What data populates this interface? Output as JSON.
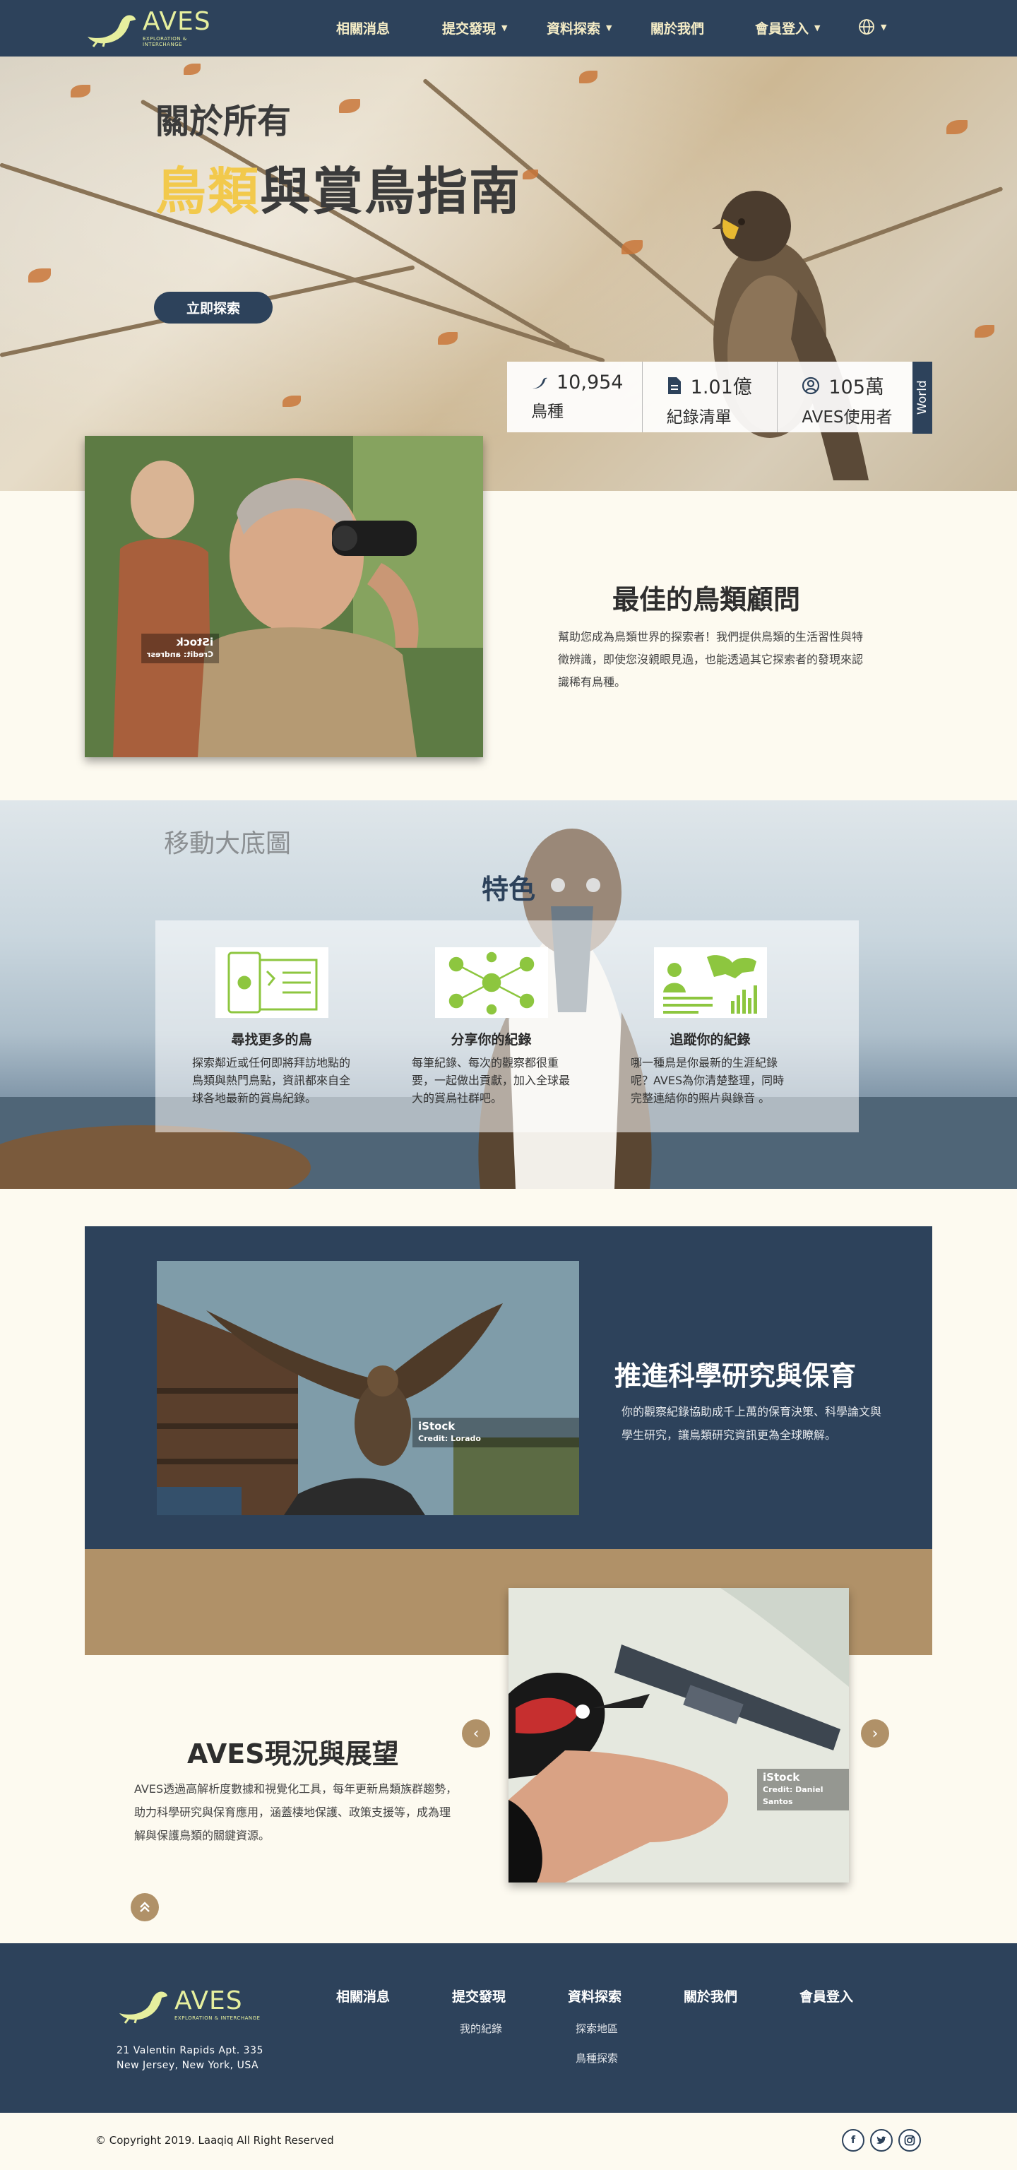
{
  "nav": {
    "brand": "AVES",
    "tagline": "EXPLORATION & INTERCHANGE",
    "items": [
      {
        "label": "相關消息",
        "has_dropdown": false
      },
      {
        "label": "提交發現",
        "has_dropdown": true
      },
      {
        "label": "資料探索",
        "has_dropdown": true
      },
      {
        "label": "關於我們",
        "has_dropdown": false
      },
      {
        "label": "會員登入",
        "has_dropdown": true
      }
    ],
    "language_icon": "globe-icon"
  },
  "hero": {
    "line1": "關於所有",
    "line2_highlight": "鳥類",
    "line2_rest": "與賞鳥指南",
    "explore_button": "立即探索",
    "stats": [
      {
        "icon": "bird-icon",
        "value": "10,954",
        "label": "鳥種"
      },
      {
        "icon": "document-icon",
        "value": "1.01億",
        "label": "紀錄清單"
      },
      {
        "icon": "user-icon",
        "value": "105萬",
        "label": "AVES使用者"
      }
    ],
    "world_tab": "World"
  },
  "advisor": {
    "photo_watermark": "iStock",
    "photo_credit": "Credit: andresr",
    "title": "最佳的鳥類顧問",
    "body": "幫助您成為鳥類世界的探索者！我們提供鳥類的生活習性與特徵辨識，即使您沒親眼見過，也能透過其它探索者的發現來認識稀有鳥種。"
  },
  "features": {
    "background_label": "移動大底圖",
    "title": "特色",
    "items": [
      {
        "icon": "map-phone-icon",
        "title": "尋找更多的鳥",
        "body": "探索鄰近或任何即將拜訪地點的鳥類與熱門鳥點，資訊都來自全球各地最新的賞鳥紀錄。"
      },
      {
        "icon": "network-icon",
        "title": "分享你的紀錄",
        "body": "每筆紀錄、每次的觀察都很重要，一起做出貢獻，加入全球最大的賞鳥社群吧。"
      },
      {
        "icon": "world-stats-icon",
        "title": "追蹤你的紀錄",
        "body": "哪一種鳥是你最新的生涯紀錄呢？AVES為你清楚整理，同時完整連結你的照片與錄音 。"
      }
    ],
    "accent": "#8dc63f"
  },
  "research": {
    "photo_watermark": "iStock",
    "photo_credit": "Credit: Lorado",
    "title": "推進科學研究與保育",
    "body": "你的觀察紀錄協助成千上萬的保育決策、科學論文與學生研究，讓鳥類研究資訊更為全球瞭解。"
  },
  "prospects": {
    "photo_watermark": "iStock",
    "photo_credit": "Credit: Daniel Santos",
    "title": "AVES現況與展望",
    "body": "AVES透過高解析度數據和視覺化工具，每年更新鳥類族群趨勢，助力科學研究與保育應用，涵蓋棲地保護、政策支援等，成為理解與保護鳥類的關鍵資源。",
    "prev_icon": "chevron-left-icon",
    "next_icon": "chevron-right-icon",
    "top_icon": "chevron-up-icon"
  },
  "footer": {
    "brand": "AVES",
    "tagline": "EXPLORATION & INTERCHANGE",
    "address_line1": "21 Valentin Rapids Apt. 335",
    "address_line2": "New Jersey, New York, USA",
    "columns": [
      {
        "label": "相關消息",
        "links": []
      },
      {
        "label": "提交發現",
        "links": [
          "我的紀錄"
        ]
      },
      {
        "label": "資料探索",
        "links": [
          "探索地區",
          "鳥種探索"
        ]
      },
      {
        "label": "關於我們",
        "links": []
      },
      {
        "label": "會員登入",
        "links": []
      }
    ],
    "copyright": "© Copyright 2019. Laaqiq All Right Reserved",
    "social": [
      "facebook-icon",
      "twitter-icon",
      "instagram-icon"
    ]
  },
  "colors": {
    "navy": "#2d425b",
    "tan": "#b09168",
    "cream": "#fdfaf0",
    "highlight": "#f2c94c",
    "logo": "#e6ef9e"
  }
}
